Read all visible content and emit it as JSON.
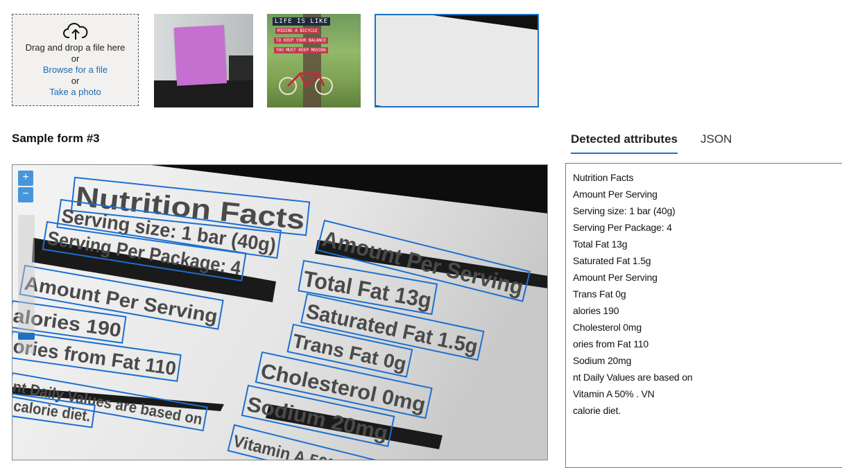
{
  "upload": {
    "drag_text": "Drag and drop a file here",
    "or_1": "or",
    "browse_link": "Browse for a file",
    "or_2": "or",
    "photo_link": "Take a photo"
  },
  "thumbnails": [
    {
      "name": "sticky-note"
    },
    {
      "name": "life-is-like-riding-a-bicycle",
      "line1": "LIFE IS LIKE",
      "line2": "RIDING A BICYCLE",
      "line3": "TO KEEP YOUR BALANCE",
      "line4": "YOU MUST KEEP MOVING"
    },
    {
      "name": "nutrition-facts",
      "selected": true
    }
  ],
  "form_title": "Sample form #3",
  "tabs": [
    {
      "label": "Detected attributes",
      "active": true
    },
    {
      "label": "JSON",
      "active": false
    }
  ],
  "viewer": {
    "zoom_in": "+",
    "zoom_out": "−",
    "detections": [
      {
        "text": "Nutrition Facts"
      },
      {
        "text": "Serving size: 1 bar (40g)"
      },
      {
        "text": "Serving Per Package: 4"
      },
      {
        "text": "Amount Per Serving"
      },
      {
        "text": "alories 190"
      },
      {
        "text": "ories from Fat 110"
      },
      {
        "text": "nt Daily Values are based on"
      },
      {
        "text": "calorie diet."
      },
      {
        "text": "Amount Per Serving"
      },
      {
        "text": "Total Fat 13g"
      },
      {
        "text": "Saturated Fat 1.5g"
      },
      {
        "text": "Trans Fat 0g"
      },
      {
        "text": "Cholesterol 0mg"
      },
      {
        "text": "Sodium 20mg"
      },
      {
        "text": "Vitamin A 50% . VN"
      }
    ]
  },
  "attributes": [
    "Nutrition Facts",
    "Amount Per Serving",
    "Serving size: 1 bar (40g)",
    "Serving Per Package: 4",
    "Total Fat 13g",
    "Saturated Fat 1.5g",
    "Amount Per Serving",
    "Trans Fat 0g",
    "alories 190",
    "Cholesterol 0mg",
    "ories from Fat 110",
    "Sodium 20mg",
    "nt Daily Values are based on",
    "Vitamin A 50% . VN",
    "calorie diet."
  ],
  "colors": {
    "accent": "#1c72c4",
    "link": "#1c6bb0",
    "box": "#1b6fd0"
  }
}
